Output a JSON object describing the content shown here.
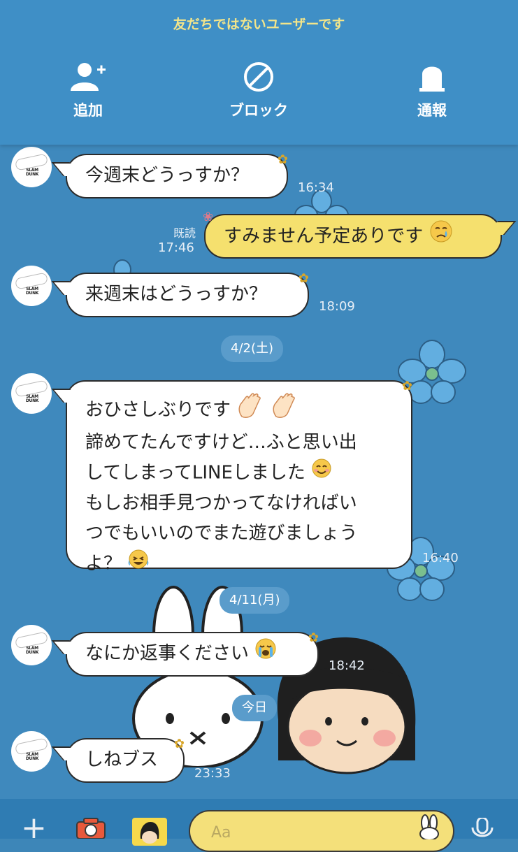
{
  "header": {
    "notice": "友だちではないユーザーです",
    "actions": [
      {
        "label": "追加",
        "icon": "add-friend-icon"
      },
      {
        "label": "ブロック",
        "icon": "block-icon"
      },
      {
        "label": "通報",
        "icon": "report-icon"
      }
    ]
  },
  "messages": [
    {
      "from": "them",
      "text": "今週末どうっすか？",
      "time": "16:34"
    },
    {
      "from": "me",
      "read": "既読",
      "text": "すみません予定ありです",
      "time": "17:46"
    },
    {
      "from": "them",
      "text": "来週末はどうっすか？",
      "time": "18:09"
    },
    {
      "date": "4/2(土)"
    },
    {
      "from": "them",
      "lines": [
        "おひさしぶりです",
        "諦めてたんですけど…ふと思い出",
        "してしまってLINEしました",
        "もしお相手見つかってなければい",
        "つでもいいのでまた遊びましょう",
        "よ？"
      ],
      "time": "16:40"
    },
    {
      "date": "4/11(月)"
    },
    {
      "from": "them",
      "text": "なにか返事ください",
      "time": "18:42"
    },
    {
      "date": "今日"
    },
    {
      "from": "them",
      "text": "しねブス",
      "time": "23:33"
    }
  ],
  "avatar": {
    "logo_text": "SLAM DUNK"
  },
  "input": {
    "placeholder": "Aa"
  },
  "colors": {
    "header": "#3f8fc6",
    "background": "#3f89bd",
    "notice": "#f3e58a",
    "my_bubble": "#f5e06e",
    "their_bubble": "#ffffff"
  }
}
